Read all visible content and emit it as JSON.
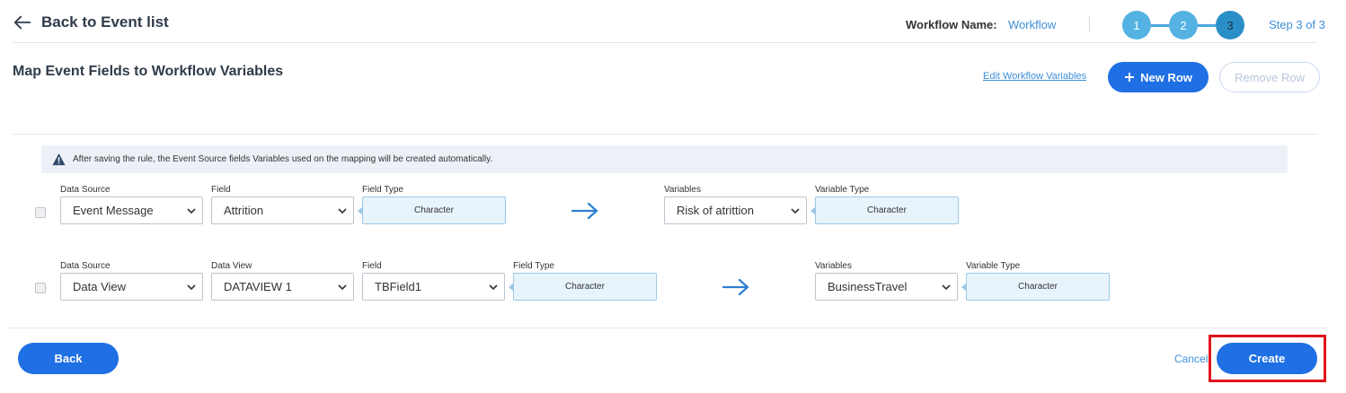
{
  "header": {
    "back_label": "Back to Event list",
    "workflow_name_label": "Workflow Name:",
    "workflow_name_value": "Workflow",
    "steps": [
      "1",
      "2",
      "3"
    ],
    "step_text": "Step 3 of 3"
  },
  "section": {
    "title": "Map Event Fields to Workflow Variables",
    "edit_link": "Edit Workflow Variables",
    "new_row_label": "New Row",
    "remove_row_label": "Remove Row"
  },
  "info": {
    "message": "After saving the rule, the Event Source fields Variables used on the mapping will be created automatically."
  },
  "rows": [
    {
      "data_source_label": "Data Source",
      "data_source_value": "Event Message",
      "field_label": "Field",
      "field_value": "Attrition",
      "field_type_label": "Field Type",
      "field_type_value": "Character",
      "variables_label": "Variables",
      "variables_value": "Risk of atrittion",
      "variable_type_label": "Variable Type",
      "variable_type_value": "Character"
    },
    {
      "data_source_label": "Data Source",
      "data_source_value": "Data View",
      "data_view_label": "Data View",
      "data_view_value": "DATAVIEW 1",
      "field_label": "Field",
      "field_value": "TBField1",
      "field_type_label": "Field Type",
      "field_type_value": "Character",
      "variables_label": "Variables",
      "variables_value": "BusinessTravel",
      "variable_type_label": "Variable Type",
      "variable_type_value": "Character"
    }
  ],
  "footer": {
    "back_label": "Back",
    "cancel_label": "Cancel",
    "create_label": "Create"
  },
  "colors": {
    "primary": "#1f6fe5",
    "link": "#3d8fd8",
    "highlight": "#e0141e"
  }
}
